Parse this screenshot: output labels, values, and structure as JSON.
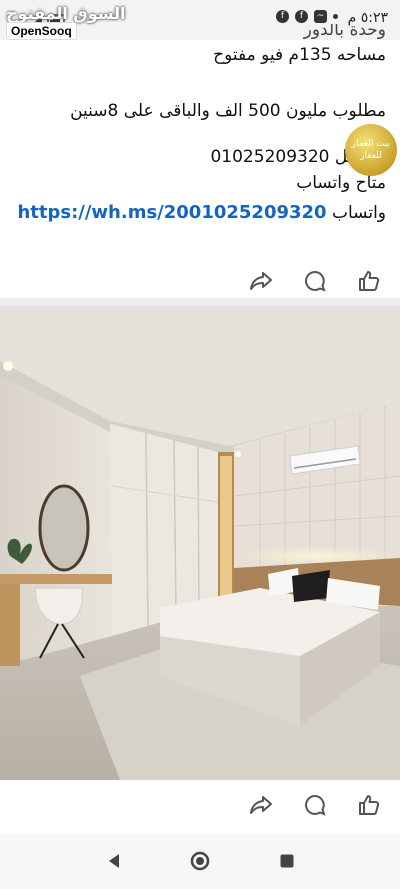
{
  "status": {
    "time": "٥:٢٣ م",
    "watermark": "السوق المفتوح",
    "brand": "OpenSooq"
  },
  "post": {
    "lines": [
      "وحدة بالدور",
      "مساحه 135م فيو مفتوح",
      "مطلوب مليون 500 الف  والباقى على 8سنين",
      "لتواصل 01025209320",
      "متاح واتساب"
    ],
    "whatsapp_label": "واتساب",
    "whatsapp_link": "https://wh.ms/2001025209320",
    "badge_text": "بيت العمار للعقار"
  },
  "colors": {
    "link": "#1565c0",
    "status_bg": "#f2f3f5",
    "divider": "#eceef1"
  },
  "icons": {
    "share": "share-icon",
    "comment": "comment-icon",
    "like": "like-icon",
    "back": "back-triangle-icon",
    "home": "home-circle-icon",
    "recents": "recents-square-icon"
  }
}
